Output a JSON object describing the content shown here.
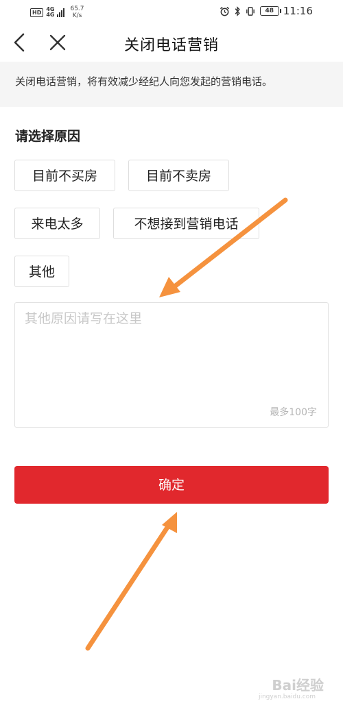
{
  "status_bar": {
    "hd": "HD",
    "network": [
      "4G",
      "4G"
    ],
    "speed_value": "65.7",
    "speed_unit": "K/s",
    "battery": "48",
    "time": "11:16"
  },
  "nav": {
    "title": "关闭电话营销",
    "back_icon": "chevron-left-icon",
    "close_icon": "close-icon"
  },
  "notice": {
    "text": "关闭电话营销，将有效减少经纪人向您发起的营销电话。"
  },
  "reasons": {
    "title": "请选择原因",
    "options": [
      "目前不买房",
      "目前不卖房",
      "来电太多",
      "不想接到营销电话",
      "其他"
    ]
  },
  "other_reason": {
    "placeholder": "其他原因请写在这里",
    "value": "",
    "limit": "最多100字"
  },
  "submit": {
    "label": "确定",
    "color": "#e1282d"
  },
  "annotation": {
    "arrow_color": "#f5923e"
  },
  "watermark": {
    "brand": "Bai经验",
    "url": "jingyan.baidu.com"
  }
}
